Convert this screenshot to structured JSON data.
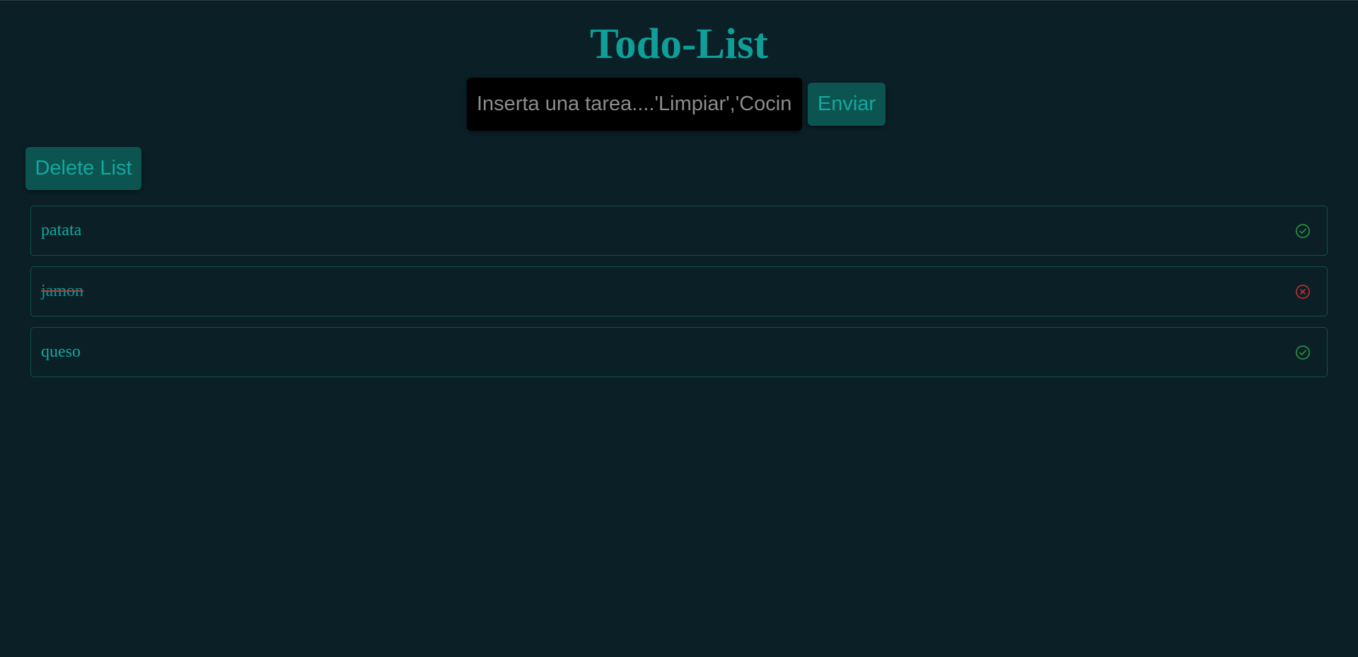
{
  "header": {
    "title": "Todo-List"
  },
  "form": {
    "placeholder": "Inserta una tarea....'Limpiar','Cocinar'",
    "value": "",
    "submit_label": "Enviar"
  },
  "actions": {
    "delete_label": "Delete List"
  },
  "todos": [
    {
      "text": "patata",
      "completed": false,
      "icon": "check-circle-icon",
      "icon_color": "#2ea043"
    },
    {
      "text": "jamon",
      "completed": true,
      "icon": "x-circle-icon",
      "icon_color": "#d0312d"
    },
    {
      "text": "queso",
      "completed": false,
      "icon": "check-circle-icon",
      "icon_color": "#2ea043"
    }
  ],
  "colors": {
    "background": "#0a2026",
    "accent": "#0f9e98",
    "button_bg": "#0c5450",
    "done_strike": "#b04040"
  }
}
